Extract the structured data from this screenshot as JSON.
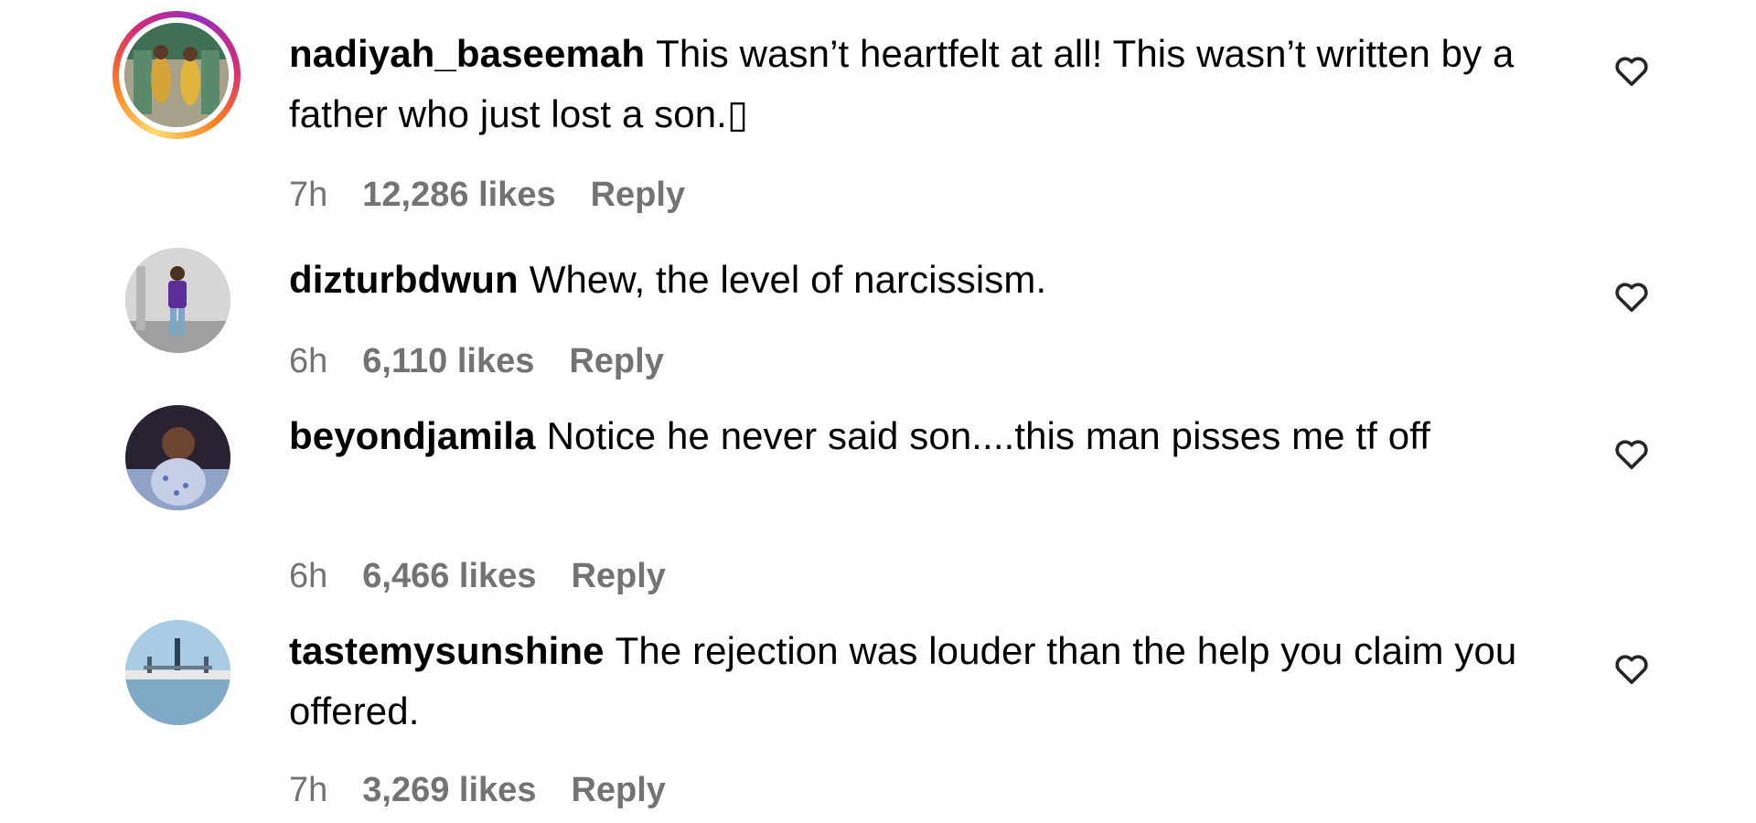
{
  "comments": [
    {
      "username": "nadiyah_baseemah",
      "text": "This wasn’t heartfelt at all! This wasn’t written by a father who just lost a son.▯",
      "time": "7h",
      "likes": "12,286 likes",
      "reply": "Reply",
      "icon": "heart-outline-icon"
    },
    {
      "username": "dizturbdwun",
      "text": "Whew, the level of narcissism.",
      "time": "6h",
      "likes": "6,110 likes",
      "reply": "Reply",
      "icon": "heart-outline-icon"
    },
    {
      "username": "beyondjamila",
      "text": "Notice he never said son....this man pisses me tf off",
      "time": "6h",
      "likes": "6,466 likes",
      "reply": "Reply",
      "icon": "heart-outline-icon"
    },
    {
      "username": "tastemysunshine",
      "text": "The rejection was louder than the help you claim you offered.",
      "time": "7h",
      "likes": "3,269 likes",
      "reply": "Reply",
      "icon": "heart-outline-icon"
    }
  ],
  "colors": {
    "text": "#000000",
    "meta": "#737373",
    "story_ring": [
      "#feda75",
      "#fa7e1e",
      "#d62976",
      "#962fbf"
    ]
  }
}
